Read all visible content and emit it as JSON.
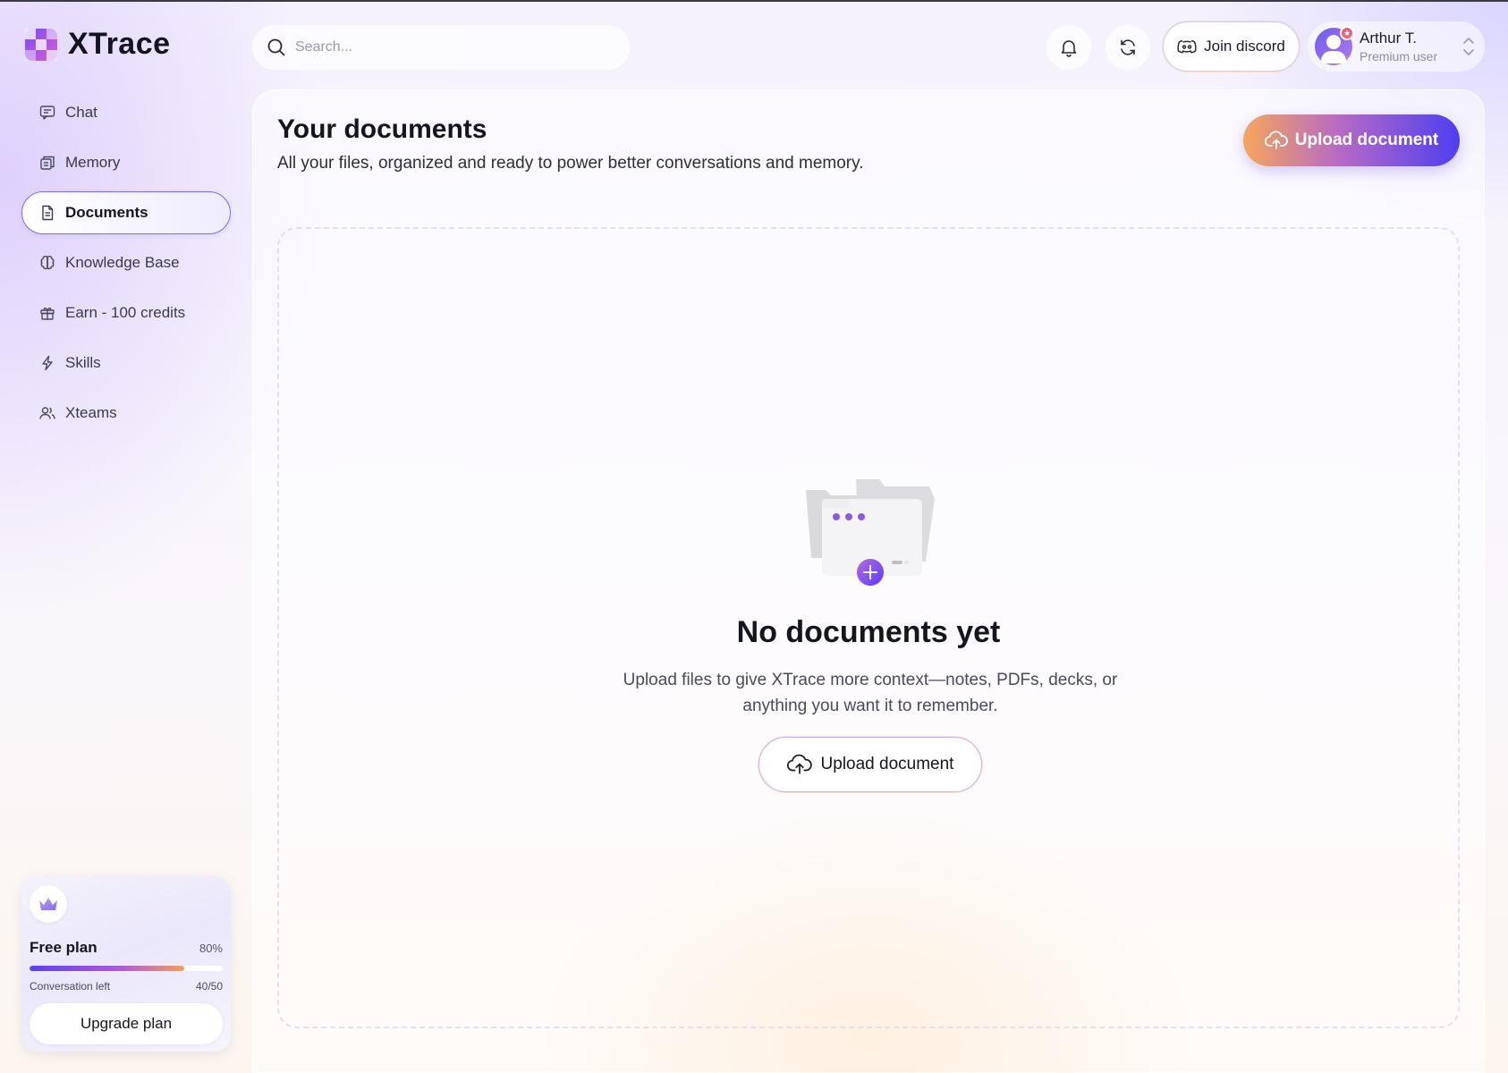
{
  "app": {
    "name": "XTrace"
  },
  "sidebar": {
    "items": [
      {
        "label": "Chat",
        "icon": "chat-icon",
        "active": false
      },
      {
        "label": "Memory",
        "icon": "memory-icon",
        "active": false
      },
      {
        "label": "Documents",
        "icon": "document-icon",
        "active": true
      },
      {
        "label": "Knowledge Base",
        "icon": "brain-icon",
        "active": false
      },
      {
        "label": "Earn - 100 credits",
        "icon": "gift-icon",
        "active": false
      },
      {
        "label": "Skills",
        "icon": "bolt-icon",
        "active": false
      },
      {
        "label": "Xteams",
        "icon": "users-icon",
        "active": false
      }
    ]
  },
  "plan": {
    "name": "Free plan",
    "percent_label": "80%",
    "usage_fraction": 0.8,
    "conversation_label": "Conversation left",
    "conversation_count": "40/50",
    "upgrade_label": "Upgrade plan",
    "icon": "crown-icon"
  },
  "header": {
    "search_placeholder": "Search...",
    "discord_label": "Join discord",
    "user": {
      "name": "Arthur T.",
      "role": "Premium user"
    }
  },
  "main": {
    "title": "Your documents",
    "subtitle": "All your files, organized and ready to power better conversations and memory.",
    "upload_label": "Upload document",
    "empty": {
      "title": "No documents yet",
      "description": "Upload files to give XTrace more context—notes, PDFs, decks, or anything you want it to remember.",
      "upload_label": "Upload document"
    }
  },
  "colors": {
    "accent": "#5b3ff0",
    "accent_orange": "#f6a65c",
    "active_border": "#7b6cf0"
  }
}
